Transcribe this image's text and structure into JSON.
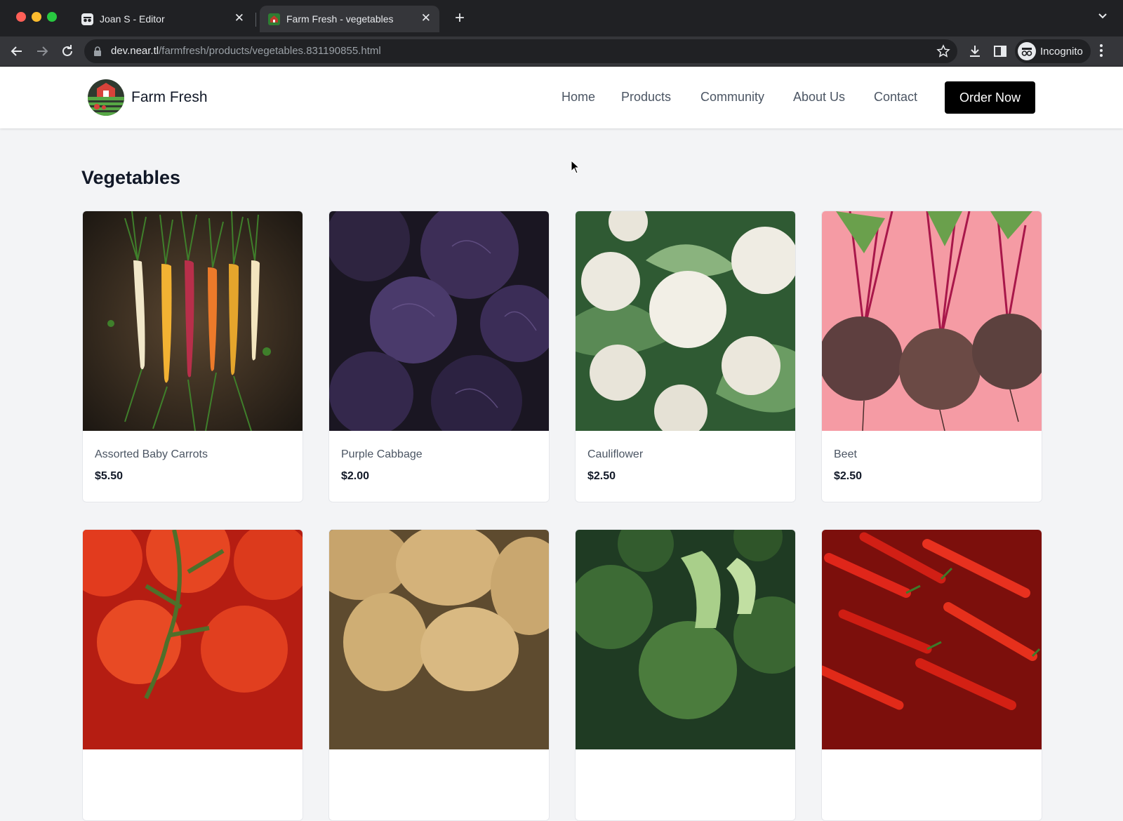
{
  "browser": {
    "tabs": [
      {
        "title": "Joan S - Editor",
        "active": false
      },
      {
        "title": "Farm Fresh - vegetables",
        "active": true
      }
    ],
    "url_host": "dev.near.tl",
    "url_path": "/farmfresh/products/vegetables.831190855.html",
    "profile_label": "Incognito"
  },
  "site": {
    "brand": "Farm Fresh",
    "nav": [
      "Home",
      "Products",
      "Community",
      "About Us",
      "Contact"
    ],
    "cta": "Order Now"
  },
  "page": {
    "title": "Vegetables",
    "products": [
      {
        "name": "Assorted Baby Carrots",
        "price": "$5.50",
        "image": "carrots"
      },
      {
        "name": "Purple Cabbage",
        "price": "$2.00",
        "image": "cabbage"
      },
      {
        "name": "Cauliflower",
        "price": "$2.50",
        "image": "cauliflower"
      },
      {
        "name": "Beet",
        "price": "$2.50",
        "image": "beet"
      },
      {
        "name": "",
        "price": "",
        "image": "tomatoes"
      },
      {
        "name": "",
        "price": "",
        "image": "potatoes"
      },
      {
        "name": "",
        "price": "",
        "image": "broccoli"
      },
      {
        "name": "",
        "price": "",
        "image": "chili-peppers"
      }
    ]
  },
  "colors": {
    "chrome_dark": "#202124",
    "chrome_mid": "#35363a",
    "page_bg": "#f3f4f6",
    "cta_bg": "#000000"
  }
}
